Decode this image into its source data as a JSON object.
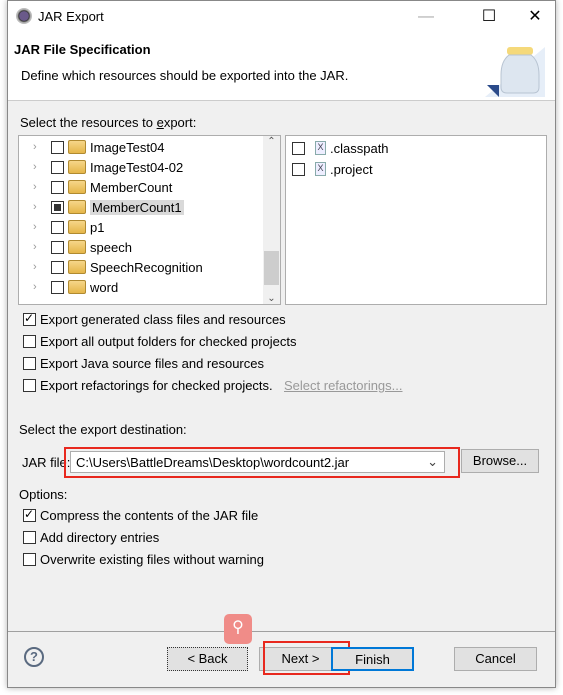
{
  "window": {
    "title": "JAR Export"
  },
  "header": {
    "title": "JAR File Specification",
    "description": "Define which resources should be exported into the JAR."
  },
  "resources": {
    "label": "Select the resources to export:",
    "projects": [
      {
        "name": "ImageTest04",
        "state": "unchecked"
      },
      {
        "name": "ImageTest04-02",
        "state": "unchecked"
      },
      {
        "name": "MemberCount",
        "state": "unchecked"
      },
      {
        "name": "MemberCount1",
        "state": "partial"
      },
      {
        "name": "p1",
        "state": "unchecked"
      },
      {
        "name": "speech",
        "state": "unchecked"
      },
      {
        "name": "SpeechRecognition",
        "state": "unchecked"
      },
      {
        "name": "word",
        "state": "unchecked"
      }
    ],
    "files": [
      {
        "name": ".classpath"
      },
      {
        "name": ".project"
      }
    ]
  },
  "export_options": [
    {
      "label": "Export generated class files and resources",
      "checked": true
    },
    {
      "label": "Export all output folders for checked projects",
      "checked": false
    },
    {
      "label": "Export Java source files and resources",
      "checked": false
    },
    {
      "label": "Export refactorings for checked projects.",
      "checked": false
    }
  ],
  "select_refactorings": "Select refactorings...",
  "destination": {
    "label": "Select the export destination:",
    "jar_label": "JAR file:",
    "value": "C:\\Users\\BattleDreams\\Desktop\\wordcount2.jar",
    "browse": "Browse..."
  },
  "options": {
    "label": "Options:",
    "items": [
      {
        "label": "Compress the contents of the JAR file",
        "checked": true
      },
      {
        "label": "Add directory entries",
        "checked": false
      },
      {
        "label": "Overwrite existing files without warning",
        "checked": false
      }
    ]
  },
  "buttons": {
    "back": "< Back",
    "next": "Next >",
    "finish": "Finish",
    "cancel": "Cancel"
  },
  "colors": {
    "highlight": "#e8281e",
    "default_button": "#0078d7"
  }
}
